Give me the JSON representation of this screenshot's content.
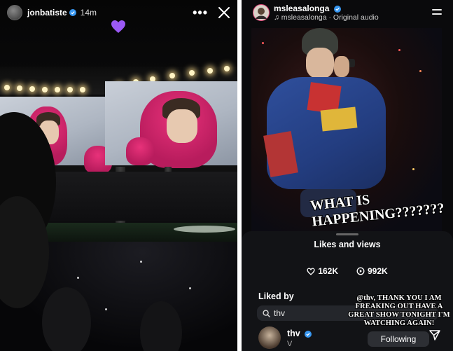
{
  "left_story": {
    "username": "jonbatiste",
    "time": "14m",
    "more_label": "•••",
    "reaction": "💜"
  },
  "right_reel": {
    "username": "msleasalonga",
    "audio_line": "♫ msleasalonga · Original audio",
    "caption_big": "WHAT IS HAPPENING???????",
    "caption_small": "@thv, THANK YOU I AM FREAKING OUT HAVE A GREAT SHOW TONIGHT I'M WATCHING AGAIN!",
    "sheet": {
      "title": "Likes and views",
      "likes": "162K",
      "views": "992K",
      "liked_by_label": "Liked by",
      "search_value": "thv",
      "user": {
        "name": "thv",
        "subtitle": "V",
        "follow_label": "Following"
      }
    }
  },
  "colors": {
    "verified": "#3897f0",
    "heart": "#9b59f5",
    "hoodie": "#d42a6e"
  }
}
